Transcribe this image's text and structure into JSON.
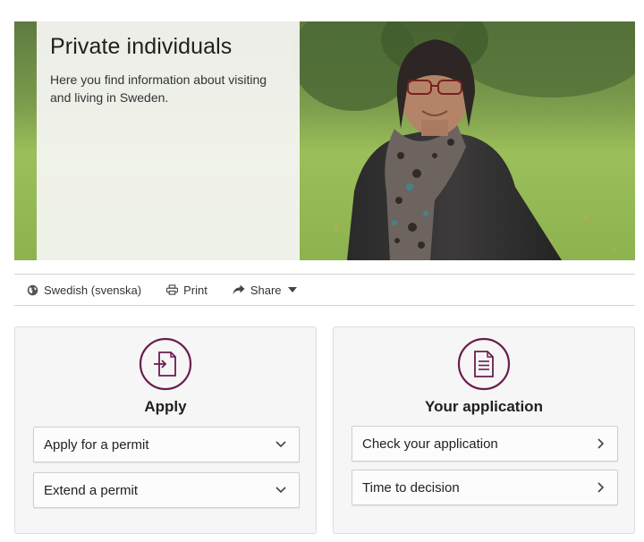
{
  "hero": {
    "title": "Private individuals",
    "description": "Here you find information about visiting and living in Sweden."
  },
  "toolbar": {
    "language": "Swedish (svenska)",
    "print": "Print",
    "share": "Share"
  },
  "cards": {
    "apply": {
      "title": "Apply",
      "icon": "document-arrow-icon",
      "items": [
        {
          "label": "Apply for a permit",
          "icon": "chevron-down-icon"
        },
        {
          "label": "Extend a permit",
          "icon": "chevron-down-icon"
        }
      ]
    },
    "application": {
      "title": "Your application",
      "icon": "document-lines-icon",
      "items": [
        {
          "label": "Check your application",
          "icon": "chevron-right-icon"
        },
        {
          "label": "Time to decision",
          "icon": "chevron-right-icon"
        }
      ]
    }
  },
  "colors": {
    "accent": "#6b1d4f",
    "card_bg": "#f6f6f6",
    "border": "#d4d4d4"
  }
}
